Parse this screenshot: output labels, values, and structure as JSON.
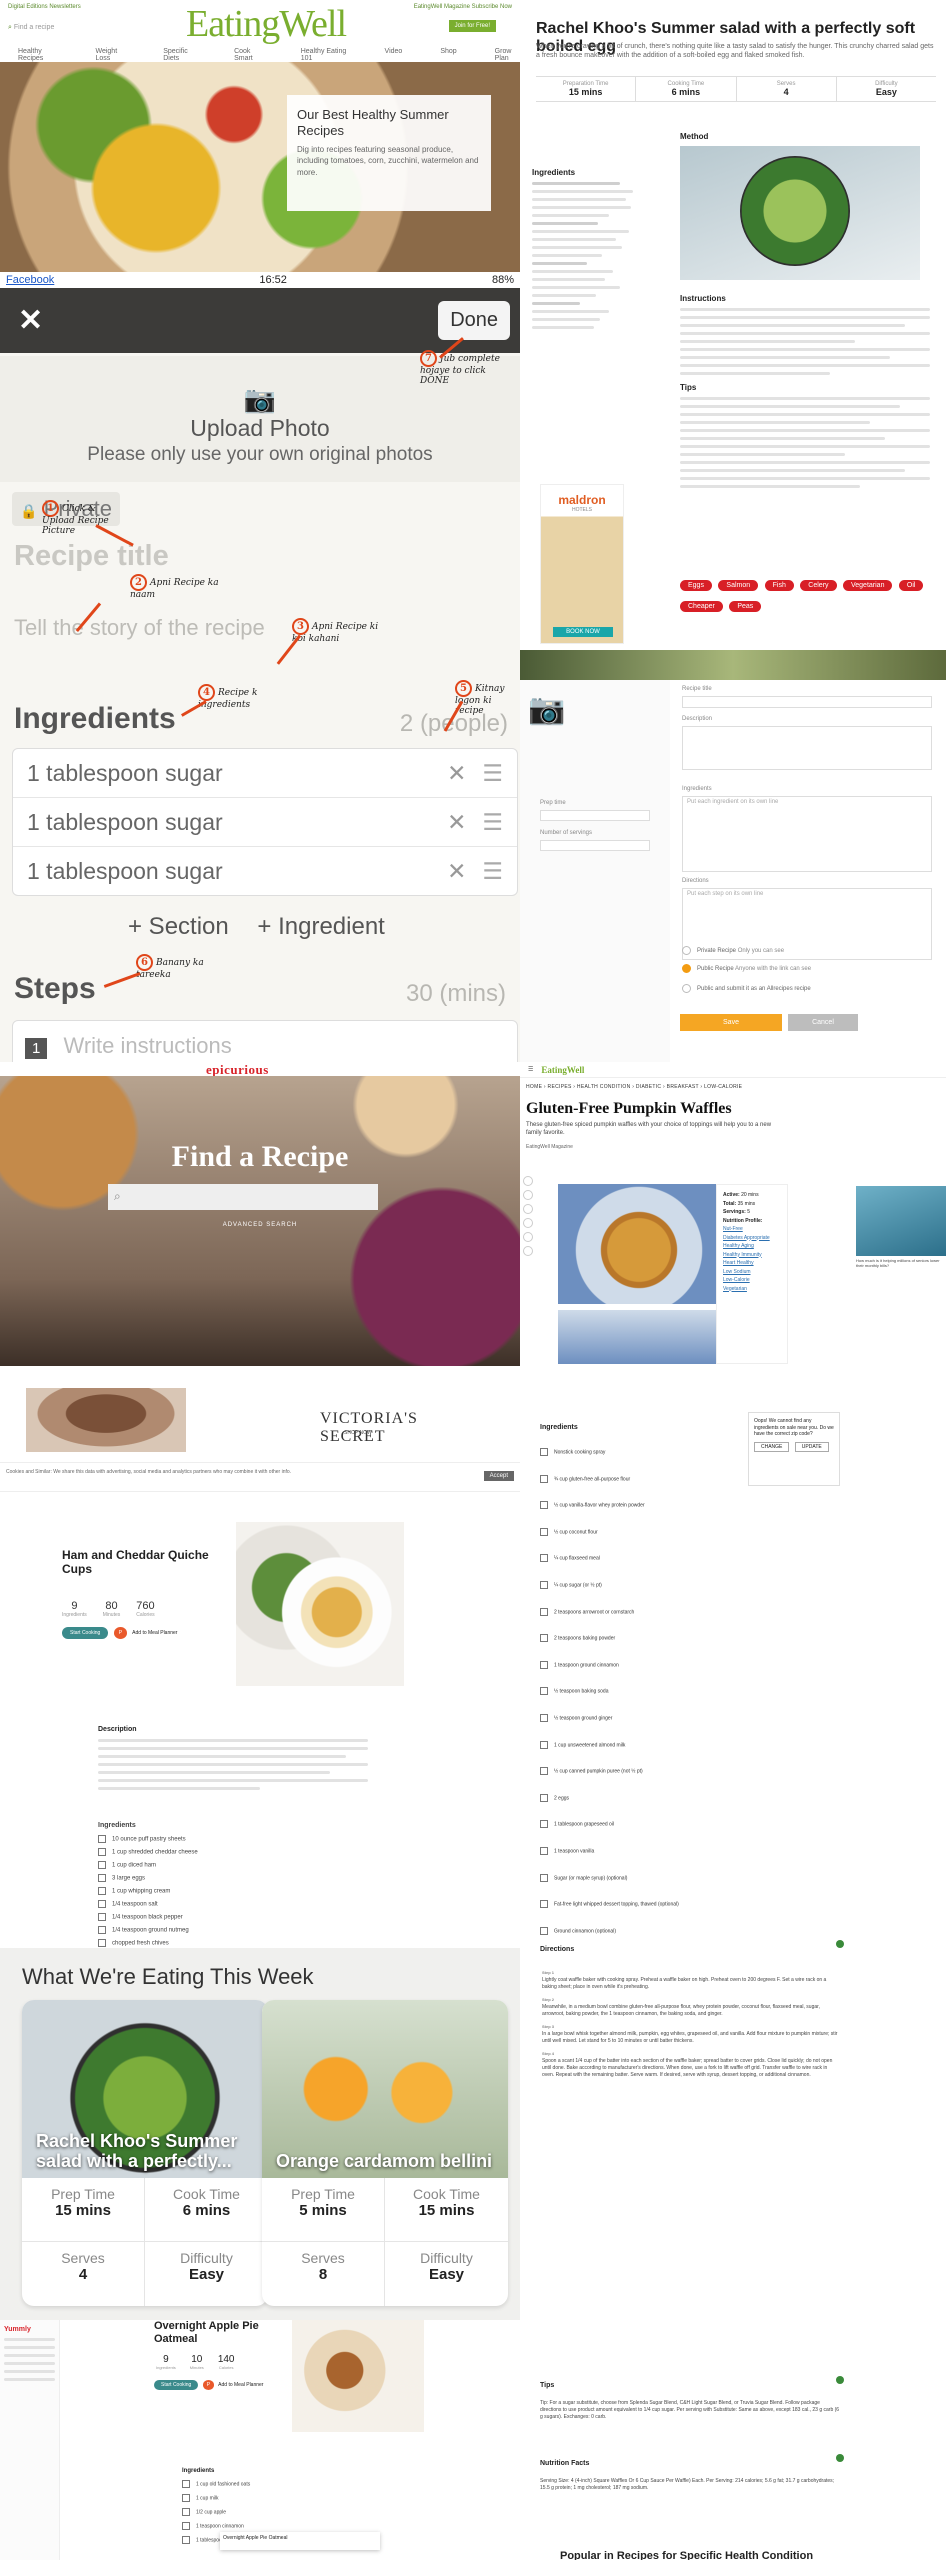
{
  "eatingwell": {
    "top_links": "Digital Editions    Newsletters",
    "logo": "EatingWell",
    "top_right": "EatingWell Magazine  Subscribe Now",
    "join": "Join for Free!",
    "search_placeholder": "Find a recipe",
    "nav": [
      "Healthy Recipes",
      "Weight Loss",
      "Specific Diets",
      "Cook Smart",
      "Healthy Eating 101",
      "Video",
      "Shop",
      "Grow Plan"
    ],
    "card_title": "Our Best Healthy Summer Recipes",
    "card_text": "Dig into recipes featuring seasonal produce, including tomatoes, corn, zucchini, watermelon and more."
  },
  "cookpad": {
    "status_back": "Facebook",
    "status_time": "16:52",
    "status_battery": "88%",
    "close": "✕",
    "done": "Done",
    "upload": "Upload Photo",
    "upload_note": "Please only use your own original photos",
    "private": "Private",
    "title_placeholder": "Recipe title",
    "story_placeholder": "Tell the story of the recipe",
    "ingredients_heading": "Ingredients",
    "people": "2 (people)",
    "ingredients": [
      "1 tablespoon sugar",
      "1 tablespoon sugar",
      "1 tablespoon sugar"
    ],
    "add_section": "+ Section",
    "add_ingredient": "+ Ingredient",
    "steps_heading": "Steps",
    "steps_time": "30 (mins)",
    "step_number": "1",
    "step_placeholder": "Write instructions",
    "annotations": [
      {
        "num": "1",
        "text": "Click & Upload Recipe Picture"
      },
      {
        "num": "2",
        "text": "Apni Recipe ka naam"
      },
      {
        "num": "3",
        "text": "Apni Recipe ki koi kahani"
      },
      {
        "num": "4",
        "text": "Recipe k ingredients"
      },
      {
        "num": "5",
        "text": "Kitnay logon ki recipe"
      },
      {
        "num": "6",
        "text": "Banany ka tareeka"
      },
      {
        "num": "7",
        "text": "Jub complete hojaye to click DONE"
      }
    ]
  },
  "rachel": {
    "title": "Rachel Khoo's Summer salad with a perfectly soft boiled egg",
    "intro": "When you're craving a bit of crunch, there's nothing quite like a tasty salad to satisfy the hunger. This crunchy charred salad gets a fresh bounce makeover with the addition of a soft-boiled egg and flaked smoked fish.",
    "stats": [
      {
        "label": "Preparation Time",
        "value": "15 mins"
      },
      {
        "label": "Cooking Time",
        "value": "6 mins"
      },
      {
        "label": "Serves",
        "value": "4"
      },
      {
        "label": "Difficulty",
        "value": "Easy"
      }
    ],
    "ingredients_heading": "Ingredients",
    "method_heading": "Method",
    "instructions_heading": "Instructions",
    "tips_heading": "Tips",
    "ad_brand": "maldron",
    "ad_sub": "HOTELS",
    "ad_cta": "BOOK NOW",
    "tags": [
      "Eggs",
      "Salmon",
      "Fish",
      "Celery",
      "Vegetarian",
      "Oil",
      "Cheaper",
      "Peas"
    ]
  },
  "form": {
    "labels": [
      "Recipe title",
      "Description",
      "Prep time",
      "Number of servings",
      "Ingredients",
      "Directions"
    ],
    "ingredients_placeholder": "Put each ingredient on its own line",
    "directions_placeholder": "Put each step on its own line",
    "radios": [
      {
        "label": "Private Recipe",
        "sub": "Only you can see",
        "on": false
      },
      {
        "label": "Public Recipe",
        "sub": "Anyone with the link can see",
        "on": true
      },
      {
        "label": "Public and submit it as an Allrecipes recipe",
        "sub": "",
        "on": false
      }
    ],
    "save": "Save",
    "cancel": "Cancel"
  },
  "epicurious": {
    "brand": "epicurious",
    "hero_title": "Find a Recipe",
    "search_icon": "search-icon",
    "advanced": "ADVANCED SEARCH",
    "ad_brand": "VICTORIA'S SECRET",
    "ad_sub": "SHOP NOW",
    "cookie_text": "Cookies and Similar: We share this data with advertising, social media and analytics partners who may combine it with other info.",
    "cookie_accept": "Accept",
    "recipe_title": "Ham and Cheddar Quiche Cups",
    "meta": [
      {
        "n": "9",
        "l": "Ingredients"
      },
      {
        "n": "80",
        "l": "Minutes"
      },
      {
        "n": "760",
        "l": "Calories"
      }
    ],
    "start": "Start Cooking",
    "add_plan": "Add to Meal Planner",
    "description_heading": "Description",
    "ingredients_heading": "Ingredients",
    "ingredients": [
      "10 ounce puff pastry sheets",
      "1 cup shredded cheddar cheese",
      "1 cup diced ham",
      "3 large eggs",
      "1 cup whipping cream",
      "1/4 teaspoon salt",
      "1/4 teaspoon black pepper",
      "1/4 teaspoon ground nutmeg",
      "chopped fresh chives"
    ]
  },
  "waffles": {
    "site": "EatingWell",
    "crumb": "HOME › RECIPES › HEALTH CONDITION › DIABETIC › BREAKFAST › LOW-CALORIE",
    "title": "Gluten-Free Pumpkin Waffles",
    "subtitle": "These gluten-free spiced pumpkin waffles with your choice of toppings will help you to a new family favorite.",
    "by": "EatingWell Magazine",
    "nutr": [
      {
        "k": "Active:",
        "v": "20 mins"
      },
      {
        "k": "Total:",
        "v": "35 mins"
      },
      {
        "k": "Servings:",
        "v": "5"
      },
      {
        "k": "Nutrition Profile:",
        "v": ""
      }
    ],
    "nutr_links": [
      "Nut-Free",
      "Diabetes Appropriate",
      "Healthy Aging",
      "Healthy Immunity",
      "Heart Healthy",
      "Low Sodium",
      "Low-Calorie",
      "Vegetarian"
    ],
    "ad_caption": "How much is it helping millions of seniors lower their monthly bills?",
    "ingredients_heading": "Ingredients",
    "ingredients": [
      "Nonstick cooking spray",
      "¾ cup gluten-free all-purpose flour",
      "½ cup vanilla-flavor whey protein powder",
      "½ cup coconut flour",
      "¼ cup flaxseed meal",
      "¼ cup sugar (or ½ pt)",
      "2 teaspoons arrowroot or cornstarch",
      "2 teaspoons baking powder",
      "1 teaspoon ground cinnamon",
      "½ teaspoon baking soda",
      "½ teaspoon ground ginger",
      "1 cup unsweetened almond milk",
      "½ cup canned pumpkin puree (not ½ pt)",
      "2 eggs",
      "1 tablespoon grapeseed oil",
      "1 teaspoon vanilla",
      "Sugar (or maple syrup) (optional)",
      "Fat-free light whipped dessert topping, thawed (optional)",
      "Ground cinnamon (optional)"
    ],
    "notice": "Oops! We cannot find any ingredients on sale near you. Do we have the correct zip code?",
    "notice_btns": [
      "CHANGE",
      "UPDATE"
    ],
    "directions_heading": "Directions",
    "steps": [
      {
        "label": "Step 1",
        "text": "Lightly coat waffle baker with cooking spray. Preheat a waffle baker on high. Preheat oven to 200 degrees F. Set a wire rack on a baking sheet; place in oven while it's preheating."
      },
      {
        "label": "Step 2",
        "text": "Meanwhile, in a medium bowl combine gluten-free all-purpose flour, whey protein powder, coconut flour, flaxseed meal, sugar, arrowroot, baking powder, the 1 teaspoon cinnamon, the baking soda, and ginger."
      },
      {
        "label": "Step 3",
        "text": "In a large bowl whisk together almond milk, pumpkin, egg whites, grapeseed oil, and vanilla. Add flour mixture to pumpkin mixture; stir until well mixed. Let stand for 5 to 10 minutes or until batter thickens."
      },
      {
        "label": "Step 4",
        "text": "Spoon a scant 1/4 cup of the batter into each section of the waffle baker; spread batter to cover grids. Close lid quickly; do not open until done. Bake according to manufacturer's directions. When done, use a fork to lift waffle off grid. Transfer waffle to wire rack in oven. Repeat with the remaining batter. Serve warm. If desired, serve with syrup, dessert topping, or additional cinnamon."
      }
    ],
    "tips_heading": "Tips",
    "tips": "Tip: For a sugar substitute, choose from Splenda Sugar Blend, C&H Light Sugar Blend, or Truvia Sugar Blend. Follow package directions to use product amount equivalent to 1/4 cup sugar. Per serving with Substitute: Same as above, except 183 cal., 23 g carb (6 g sugars). Exchanges: 0 carb.",
    "nf_heading": "Nutrition Facts",
    "nf": "Serving Size: 4 (4-inch) Square Waffles Or 6 Cup Sauce Per Waffle) Each. Per Serving: 214 calories; 5.6 g fat; 31.7 g carbohydrates; 15.5 g protein; 1 mg cholesterol; 187 mg sodium.",
    "popular": "Popular in Recipes for Specific Health Condition"
  },
  "week": {
    "heading": "What We're Eating This Week",
    "tiles": [
      {
        "title": "Rachel Khoo's Summer salad with a perfectly...",
        "prep_l": "Prep Time",
        "prep": "15 mins",
        "cook_l": "Cook Time",
        "cook": "6 mins",
        "serves_l": "Serves",
        "serves": "4",
        "diff_l": "Difficulty",
        "diff": "Easy"
      },
      {
        "title": "Orange cardamom bellini",
        "prep_l": "Prep Time",
        "prep": "5 mins",
        "cook_l": "Cook Time",
        "cook": "15 mins",
        "serves_l": "Serves",
        "serves": "8",
        "diff_l": "Difficulty",
        "diff": "Easy"
      }
    ]
  },
  "oatmeal": {
    "brand": "Yummly",
    "title": "Overnight Apple Pie Oatmeal",
    "meta": [
      {
        "n": "9",
        "l": "Ingredients"
      },
      {
        "n": "10",
        "l": "Minutes"
      },
      {
        "n": "140",
        "l": "Calories"
      }
    ],
    "ingredients_heading": "Ingredients",
    "rows": [
      "1 cup old fashioned oats",
      "1 cup milk",
      "1/2 cup apple",
      "1 teaspoon cinnamon",
      "1 tablespoon maple syrup"
    ],
    "popup": "Overnight Apple Pie Oatmeal"
  }
}
